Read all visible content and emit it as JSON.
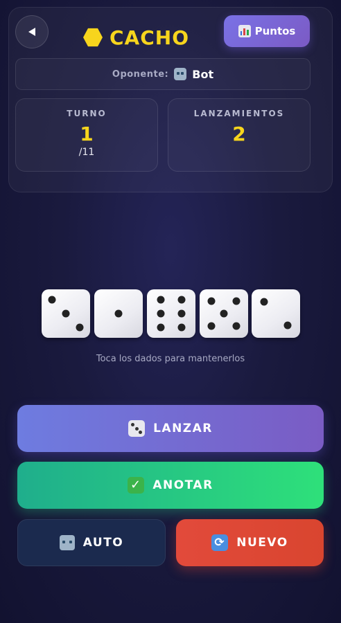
{
  "header": {
    "title": "CACHO",
    "title_icon": "yellow-hexagon",
    "back_icon": "back-arrow",
    "puntos_label": "Puntos",
    "puntos_icon": "bar-chart",
    "accent_color": "#f7d51d"
  },
  "opponent": {
    "label": "Oponente:",
    "icon": "robot",
    "name": "Bot"
  },
  "stats": {
    "turn": {
      "label": "TURNO",
      "value": "1",
      "total": "/11"
    },
    "throws": {
      "label": "LANZAMIENTOS",
      "value": "2"
    }
  },
  "dice": [
    {
      "value": 3
    },
    {
      "value": 1
    },
    {
      "value": 6
    },
    {
      "value": 5
    },
    {
      "value": 2
    }
  ],
  "hint": "Toca los dados para mantenerlos",
  "buttons": {
    "lanzar": "LANZAR",
    "anotar": "ANOTAR",
    "auto": "AUTO",
    "nuevo": "NUEVO"
  }
}
